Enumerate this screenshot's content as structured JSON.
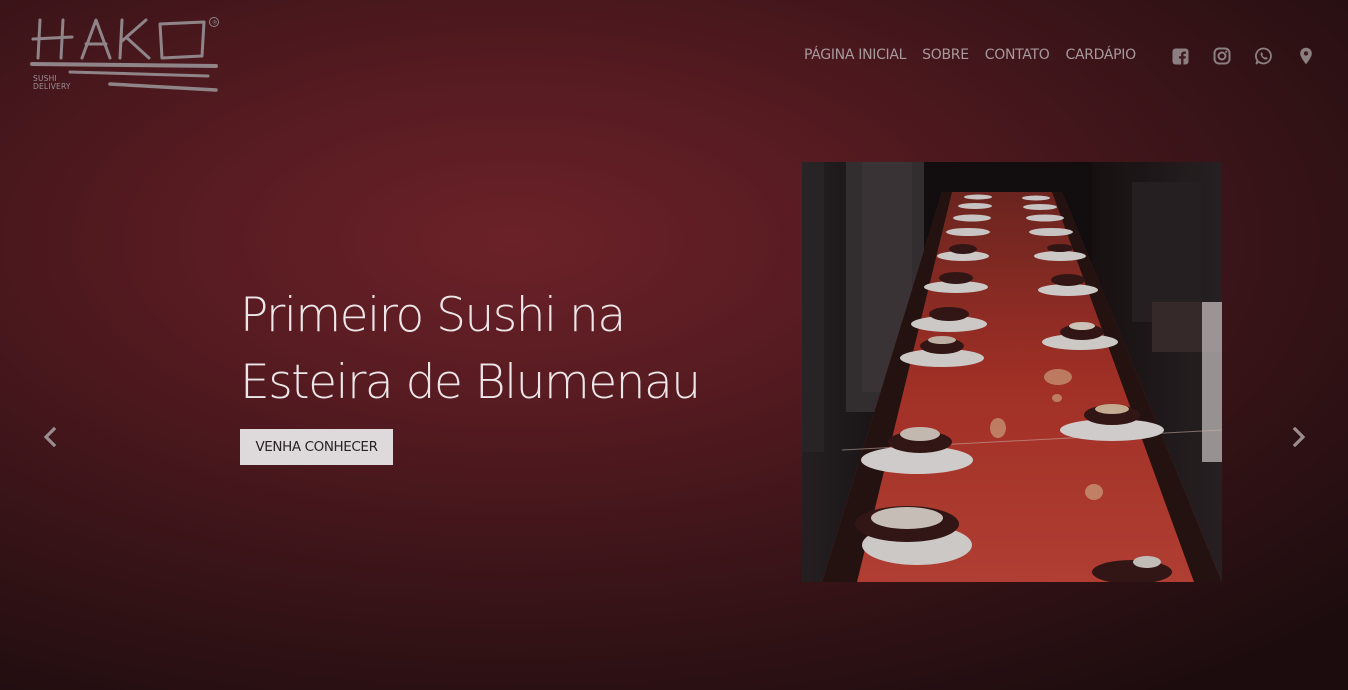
{
  "brand": {
    "name": "HAKO",
    "registered_mark": "®",
    "tagline_line1": "SUSHI",
    "tagline_line2": "DELIVERY"
  },
  "nav": {
    "items": [
      {
        "label": "PÁGINA INICIAL"
      },
      {
        "label": "SOBRE"
      },
      {
        "label": "CONTATO"
      },
      {
        "label": "CARDÁPIO"
      }
    ]
  },
  "social": {
    "icons": [
      "facebook-icon",
      "instagram-icon",
      "whatsapp-icon",
      "map-marker-icon"
    ],
    "color": "#8c7f82"
  },
  "slide": {
    "headline_line1": "Primeiro Sushi na",
    "headline_line2": "Esteira de Blumenau",
    "cta_label": "VENHA CONHECER"
  },
  "colors": {
    "background": "#561b21",
    "accent_conveyor": "#c23a2e",
    "button_bg": "#dedadb"
  }
}
